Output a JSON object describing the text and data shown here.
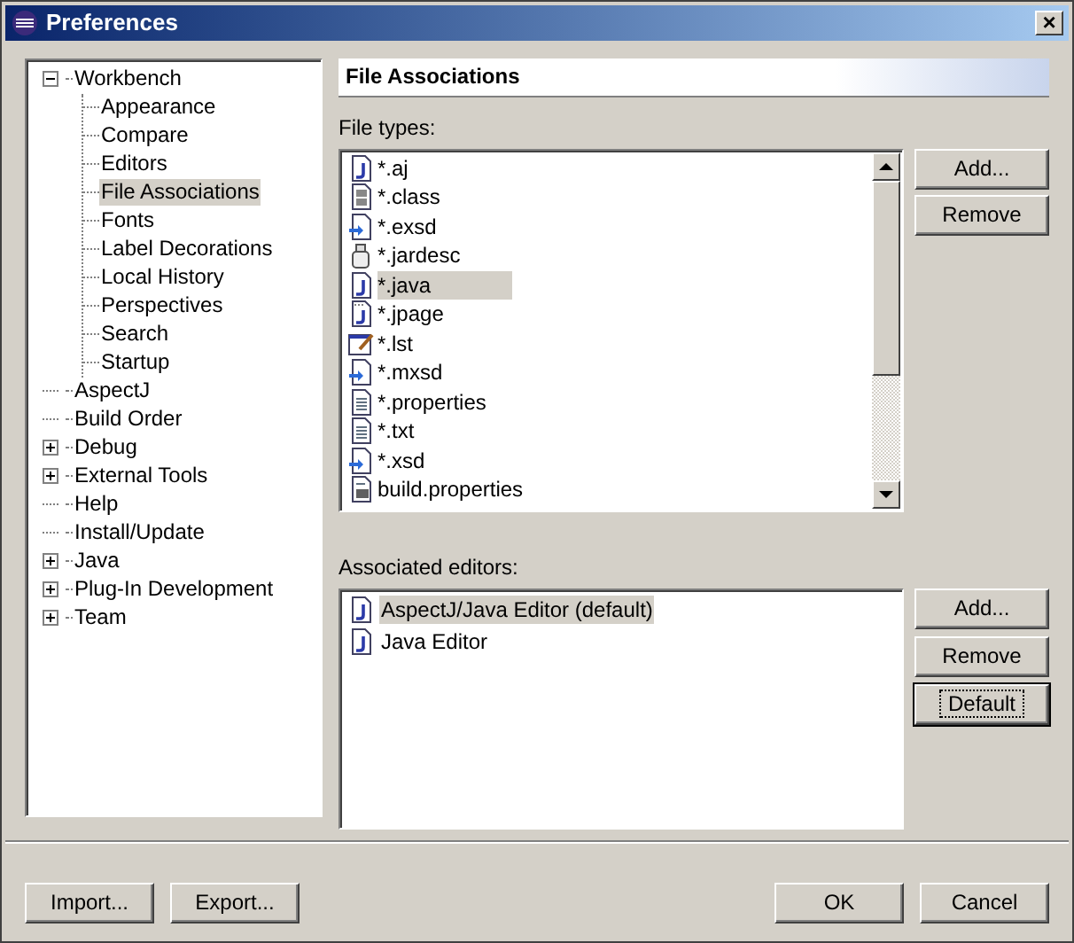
{
  "window": {
    "title": "Preferences",
    "close": "×"
  },
  "tree": [
    {
      "label": "Workbench",
      "kind": "node",
      "expanded": true,
      "selected": false,
      "children": [
        {
          "label": "Appearance",
          "selected": false
        },
        {
          "label": "Compare",
          "selected": false
        },
        {
          "label": "Editors",
          "selected": false
        },
        {
          "label": "File Associations",
          "selected": true
        },
        {
          "label": "Fonts",
          "selected": false
        },
        {
          "label": "Label Decorations",
          "selected": false
        },
        {
          "label": "Local History",
          "selected": false
        },
        {
          "label": "Perspectives",
          "selected": false
        },
        {
          "label": "Search",
          "selected": false
        },
        {
          "label": "Startup",
          "selected": false
        }
      ]
    },
    {
      "label": "AspectJ",
      "kind": "leaf",
      "selected": false
    },
    {
      "label": "Build Order",
      "kind": "leaf",
      "selected": false
    },
    {
      "label": "Debug",
      "kind": "node",
      "expanded": false,
      "selected": false
    },
    {
      "label": "External Tools",
      "kind": "node",
      "expanded": false,
      "selected": false
    },
    {
      "label": "Help",
      "kind": "leaf",
      "selected": false
    },
    {
      "label": "Install/Update",
      "kind": "leaf",
      "selected": false
    },
    {
      "label": "Java",
      "kind": "node",
      "expanded": false,
      "selected": false
    },
    {
      "label": "Plug-In Development",
      "kind": "node",
      "expanded": false,
      "selected": false
    },
    {
      "label": "Team",
      "kind": "node",
      "expanded": false,
      "selected": false
    }
  ],
  "page_title": "File Associations",
  "file_types": {
    "label": "File types:",
    "items": [
      {
        "name": "*.aj",
        "kind": "java",
        "selected": false
      },
      {
        "name": "*.class",
        "kind": "binary",
        "selected": false
      },
      {
        "name": "*.exsd",
        "kind": "schema",
        "selected": false
      },
      {
        "name": "*.jardesc",
        "kind": "jar",
        "selected": false
      },
      {
        "name": "*.java",
        "kind": "java",
        "selected": true
      },
      {
        "name": "*.jpage",
        "kind": "scrapbook",
        "selected": false
      },
      {
        "name": "*.lst",
        "kind": "edit",
        "selected": false
      },
      {
        "name": "*.mxsd",
        "kind": "schema",
        "selected": false
      },
      {
        "name": "*.properties",
        "kind": "text",
        "selected": false
      },
      {
        "name": "*.txt",
        "kind": "text",
        "selected": false
      },
      {
        "name": "*.xsd",
        "kind": "schema",
        "selected": false
      },
      {
        "name": "build.properties",
        "kind": "build",
        "selected": false
      }
    ],
    "buttons": [
      "Add...",
      "Remove"
    ]
  },
  "editors": {
    "label": "Associated editors:",
    "items": [
      {
        "name": "AspectJ/Java Editor (default)",
        "selected": true
      },
      {
        "name": "Java Editor",
        "selected": false
      }
    ],
    "buttons": [
      {
        "label": "Add...",
        "focused": false
      },
      {
        "label": "Remove",
        "focused": false
      },
      {
        "label": "Default",
        "focused": true
      }
    ]
  },
  "footer_left": [
    "Import...",
    "Export..."
  ],
  "footer_right": [
    "OK",
    "Cancel"
  ]
}
